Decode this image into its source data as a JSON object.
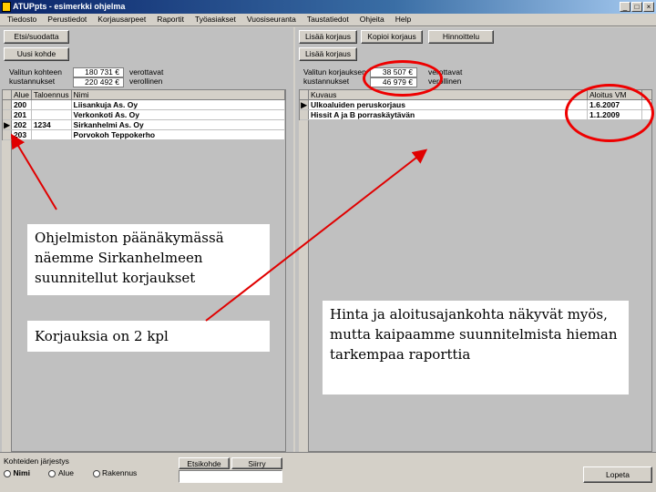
{
  "window": {
    "title": "ATUPpts - esimerkki ohjelma",
    "controls": [
      "_",
      "□",
      "×"
    ]
  },
  "menu": [
    "Tiedosto",
    "Perustiedot",
    "Korjausarpeet",
    "Raportit",
    "Työasiakset",
    "Vuosiseuranta",
    "Taustatiedot",
    "Ohjeita",
    "Help"
  ],
  "left_toolbar": {
    "btn1": "Etsi/suodatta",
    "btn2": "Uusi kohde"
  },
  "right_toolbar": {
    "btn1": "Lisää korjaus",
    "btn2": "Kopioi korjaus",
    "btn3": "Hinnoittelu",
    "btn4": "Lisää korjaus"
  },
  "left_totals": {
    "label1": "Valitun kohteen",
    "label2": "kustannukset",
    "value1": "180 731 €",
    "value2": "220 492 €",
    "suffix1": "verottavat",
    "suffix2": "verollinen"
  },
  "right_totals": {
    "label1": "Valitun korjauksen",
    "label2": "kustannukset",
    "value1": "38 507 €",
    "value2": "46 979 €",
    "suffix1": "verottavat",
    "suffix2": "verollinen"
  },
  "left_table": {
    "headers": [
      "Alue",
      "Taloennus",
      "Nimi"
    ],
    "rows": [
      [
        "200",
        "",
        "Liisankuja As. Oy"
      ],
      [
        "201",
        "",
        "Verkonkoti As. Oy"
      ],
      [
        "202",
        "1234",
        "Sirkanhelmi As. Oy"
      ],
      [
        "203",
        "",
        "Porvokoh Teppokerho"
      ]
    ],
    "selected_row_marker": "▶"
  },
  "right_table": {
    "headers": [
      "Kuvaus",
      "Aloitus VM"
    ],
    "rows": [
      [
        "Ulkoaluiden peruskorjaus",
        "1.6.2007"
      ],
      [
        "Hissit A ja B porraskäytävän",
        "1.1.2009"
      ]
    ],
    "selected_row_marker": "▶"
  },
  "notes": {
    "note1": "Ohjelmiston päänäkymässä näemme Sirkanhelmeen suunnitellut korjaukset",
    "note2": "Korjauksia on  2 kpl",
    "note3": "Hinta ja aloitusajankohta näkyvät myös, mutta kaipaamme suunnitelmista hieman tarkempaa raporttia"
  },
  "bottom": {
    "sort_label": "Kohteiden järjestys",
    "radio1": "Nimi",
    "radio2": "Alue",
    "radio3": "Rakennus",
    "tab1": "Etsikohde",
    "tab2": "Siirry",
    "close_button": "Lopeta"
  },
  "colors": {
    "annotation_red": "#e00000",
    "title_blue": "#0a246a"
  }
}
